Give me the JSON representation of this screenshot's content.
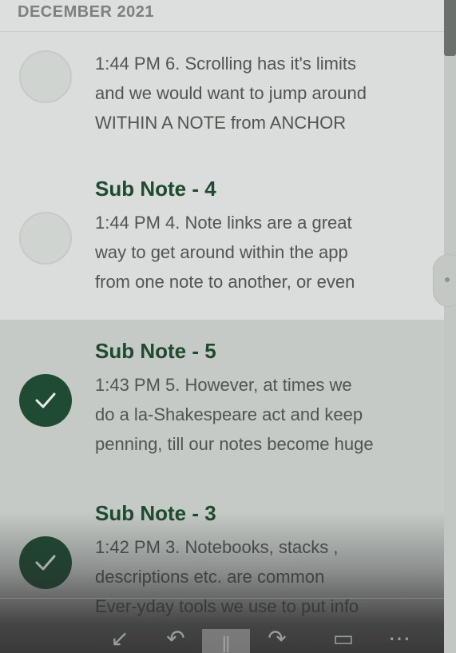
{
  "header": {
    "section_label": "DECEMBER 2021"
  },
  "notes": [
    {
      "title": "",
      "lines": [
        "1:44 PM 6. Scrolling has it's limits",
        "and we would want to jump around",
        "WITHIN A NOTE from ANCHOR"
      ],
      "checked": false
    },
    {
      "title": "Sub Note - 4",
      "lines": [
        "1:44 PM 4. Note links are a great",
        "way to get around within the app",
        "from one note to another, or even"
      ],
      "checked": false
    },
    {
      "title": "Sub Note - 5",
      "lines": [
        "1:43 PM 5. However, at times we",
        "do a la-Shakespeare act and keep",
        "penning, till our notes become huge"
      ],
      "checked": true
    },
    {
      "title": "Sub Note - 3",
      "lines": [
        "1:42 PM 3. Notebooks, stacks ,",
        "descriptions etc. are common",
        "Ever-yday tools we use to put info"
      ],
      "checked": true
    }
  ],
  "toolbar": {
    "buttons": [
      {
        "icon": "back-icon",
        "glyph": "↙"
      },
      {
        "icon": "undo-icon",
        "glyph": "↶"
      },
      {
        "icon": "pause-icon",
        "glyph": "‖"
      },
      {
        "icon": "redo-icon",
        "glyph": "↷"
      },
      {
        "icon": "keyboard-icon",
        "glyph": "▭"
      },
      {
        "icon": "more-icon",
        "glyph": "⋯"
      }
    ]
  },
  "colors": {
    "accent": "#1e4a2f",
    "check_fill": "#1f4b33",
    "background": "#dadddb",
    "selected_row": "#c5cac7"
  }
}
